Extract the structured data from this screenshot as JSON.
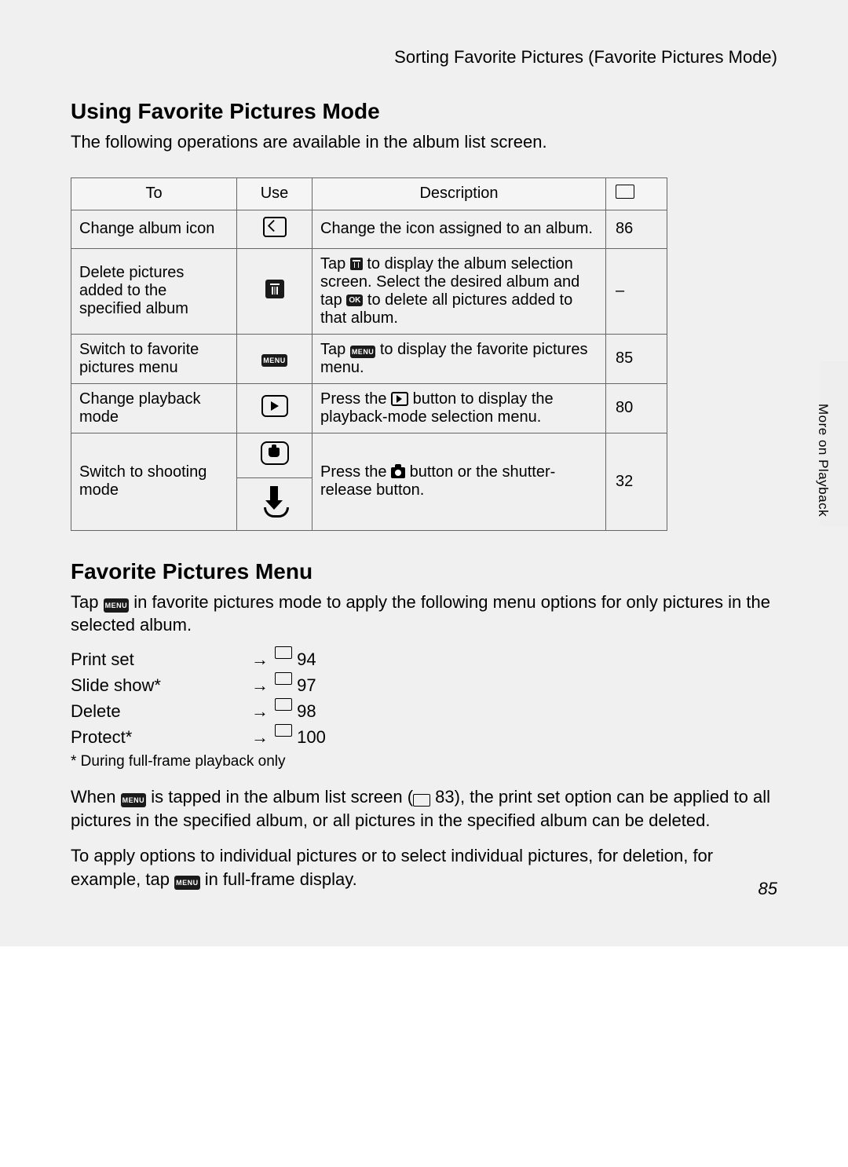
{
  "breadcrumb": "Sorting Favorite Pictures (Favorite Pictures Mode)",
  "section1_title": "Using Favorite Pictures Mode",
  "intro1": "The following operations are available in the album list screen.",
  "table": {
    "headers": {
      "to": "To",
      "use": "Use",
      "desc": "Description"
    },
    "row1": {
      "to": "Change album icon",
      "desc": "Change the icon assigned to an album.",
      "page": "86"
    },
    "row2": {
      "to": "Delete pictures added to the specified album",
      "desc_a": "Tap ",
      "desc_b": " to display the album selection screen. Select the desired album and tap ",
      "desc_c": " to delete all pictures added to that album.",
      "page": "–"
    },
    "row3": {
      "to": "Switch to favorite pictures menu",
      "desc_a": "Tap ",
      "desc_b": " to display the favorite pictures menu.",
      "page": "85"
    },
    "row4": {
      "to": "Change playback mode",
      "desc_a": "Press the ",
      "desc_b": " button to display the playback-mode selection menu.",
      "page": "80"
    },
    "row5": {
      "to": "Switch to shooting mode",
      "desc_a": "Press the ",
      "desc_b": " button or the shutter-release button.",
      "page": "32"
    }
  },
  "section2_title": "Favorite Pictures Menu",
  "intro2_a": "Tap ",
  "intro2_b": " in favorite pictures mode to apply the following menu options for only pictures in the selected album.",
  "menu_items": {
    "print_set": {
      "label": "Print set",
      "page": "94"
    },
    "slide_show": {
      "label": "Slide show*",
      "page": "97"
    },
    "delete": {
      "label": "Delete",
      "page": "98"
    },
    "protect": {
      "label": "Protect*",
      "page": "100"
    }
  },
  "footnote": "*  During full-frame playback only",
  "para1_a": "When ",
  "para1_b": " is tapped in the album list screen (",
  "para1_c": " 83), the print set option can be applied to all pictures in the specified album, or all pictures in the specified album can be deleted.",
  "para2_a": "To apply options to individual pictures or to select individual pictures, for deletion, for example, tap ",
  "para2_b": " in full-frame display.",
  "side_label": "More on Playback",
  "page_number": "85",
  "menu_badge": "MENU",
  "ok_badge": "OK",
  "arrow": "→"
}
